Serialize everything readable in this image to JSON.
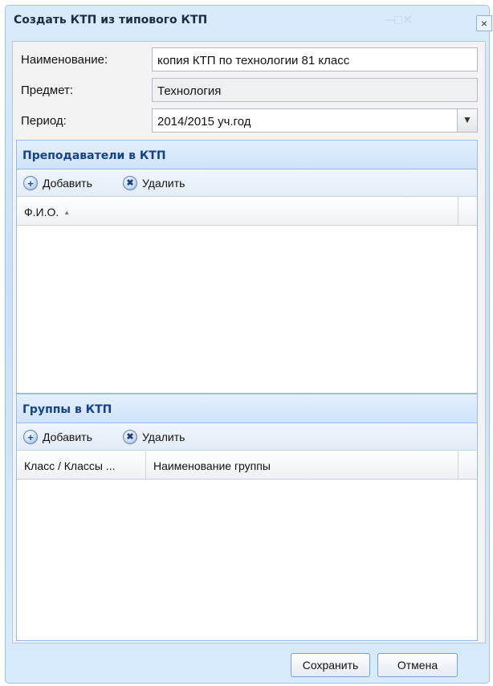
{
  "window": {
    "title": "Создать КТП из типового КТП",
    "close_label": "×"
  },
  "form": {
    "name_label": "Наименование:",
    "name_value": "копия КТП по технологии 81 класс",
    "subject_label": "Предмет:",
    "subject_value": "Технология",
    "period_label": "Период:",
    "period_value": "2014/2015 уч.год"
  },
  "teachers_panel": {
    "title": "Преподаватели в КТП",
    "add_label": "Добавить",
    "delete_label": "Удалить",
    "columns": [
      "Ф.И.О."
    ]
  },
  "groups_panel": {
    "title": "Группы в КТП",
    "add_label": "Добавить",
    "delete_label": "Удалить",
    "columns": [
      "Класс / Классы ...",
      "Наименование группы"
    ]
  },
  "footer": {
    "save_label": "Сохранить",
    "cancel_label": "Отмена"
  }
}
